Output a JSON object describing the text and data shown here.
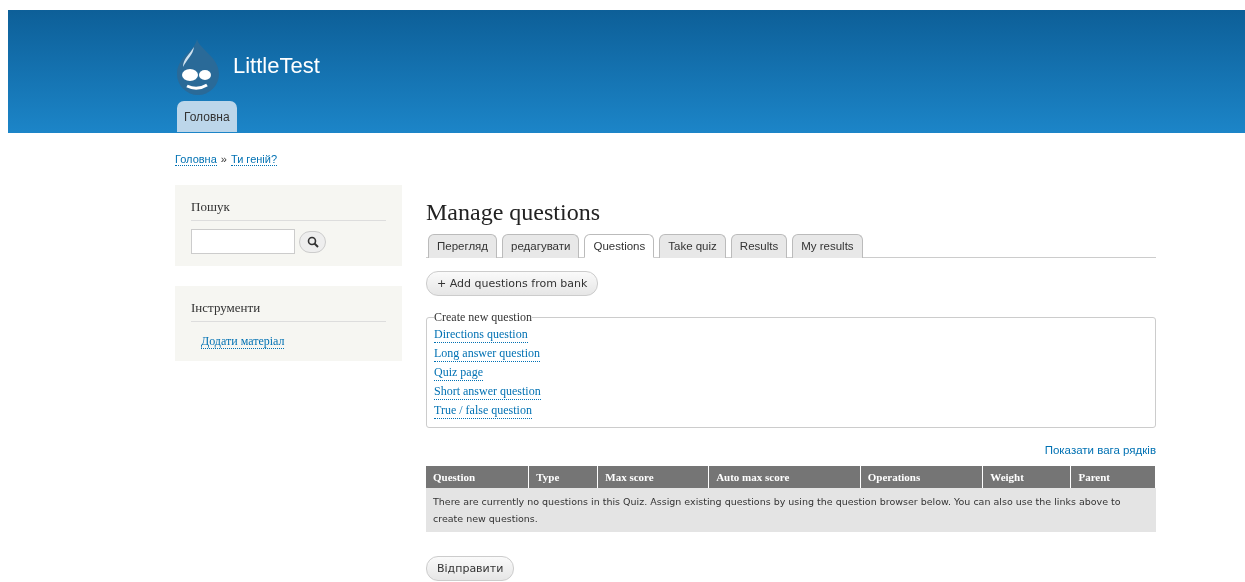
{
  "site": {
    "name": "LittleTest"
  },
  "nav": [
    {
      "label": "Головна",
      "selected": true
    }
  ],
  "breadcrumb": {
    "separator": "»",
    "items": [
      "Головна",
      "Ти геній?"
    ]
  },
  "sidebar": {
    "search": {
      "title": "Пошук"
    },
    "tools": {
      "title": "Інструменти",
      "links": [
        "Додати матеріал"
      ]
    }
  },
  "page": {
    "title": "Manage questions",
    "tabs": [
      {
        "label": "Перегляд",
        "selected": false
      },
      {
        "label": "редагувати",
        "selected": false
      },
      {
        "label": "Questions",
        "selected": true
      },
      {
        "label": "Take quiz",
        "selected": false
      },
      {
        "label": "Results",
        "selected": false
      },
      {
        "label": "My results",
        "selected": false
      }
    ],
    "add_button": "+ Add questions from bank",
    "create": {
      "legend": "Create new question",
      "links": [
        "Directions question",
        "Long answer question",
        "Quiz page",
        "Short answer question",
        "True / false question"
      ]
    },
    "weights_link": "Показати вага рядків",
    "table": {
      "columns": [
        "Question",
        "Type",
        "Max score",
        "Auto max score",
        "Operations",
        "Weight",
        "Parent"
      ],
      "empty": "There are currently no questions in this Quiz. Assign existing questions by using the question browser below. You can also use the links above to create new questions."
    },
    "submit": "Відправити"
  }
}
